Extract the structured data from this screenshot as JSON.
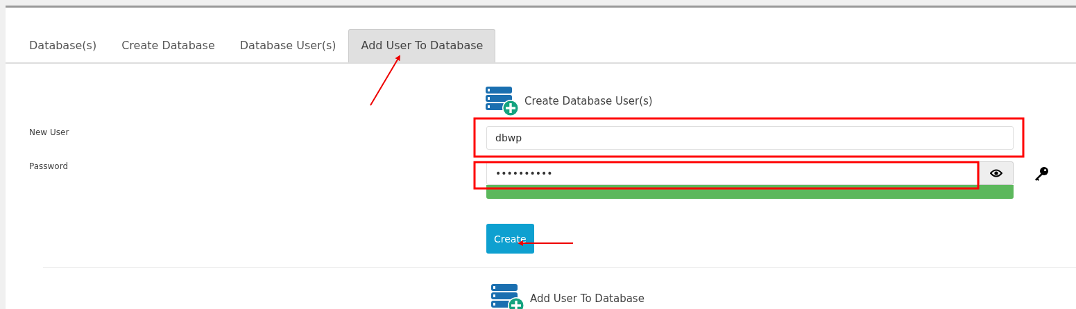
{
  "tabs": [
    {
      "label": "Database(s)",
      "selected": false
    },
    {
      "label": "Create Database",
      "selected": false
    },
    {
      "label": "Database User(s)",
      "selected": false
    },
    {
      "label": "Add User To Database",
      "selected": true
    }
  ],
  "create_section": {
    "heading": "Create Database User(s)",
    "fields": [
      {
        "kind": "text",
        "label": "New User",
        "value": "dbwp"
      },
      {
        "kind": "password",
        "label": "Password",
        "value": "••••••••••",
        "strength": {
          "level": 1.0
        }
      }
    ],
    "button": "Create"
  },
  "add_section": {
    "heading": "Add User To Database"
  }
}
